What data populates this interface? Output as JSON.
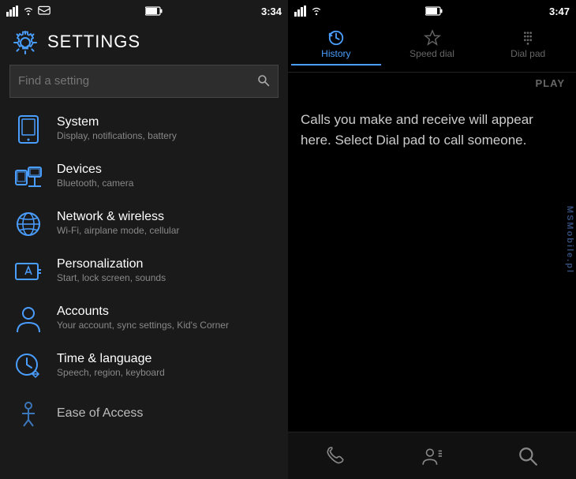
{
  "left_panel": {
    "status_bar": {
      "time": "3:34"
    },
    "header": {
      "title": "SETTINGS",
      "gear_unicode": "⚙"
    },
    "search": {
      "placeholder": "Find a setting",
      "icon": "🔍"
    },
    "settings_items": [
      {
        "id": "system",
        "title": "System",
        "subtitle": "Display, notifications, battery",
        "icon_type": "phone-outline"
      },
      {
        "id": "devices",
        "title": "Devices",
        "subtitle": "Bluetooth, camera",
        "icon_type": "devices"
      },
      {
        "id": "network",
        "title": "Network & wireless",
        "subtitle": "Wi-Fi, airplane mode, cellular",
        "icon_type": "network"
      },
      {
        "id": "personalization",
        "title": "Personalization",
        "subtitle": "Start, lock screen, sounds",
        "icon_type": "personalization"
      },
      {
        "id": "accounts",
        "title": "Accounts",
        "subtitle": "Your account, sync settings, Kid's Corner",
        "icon_type": "accounts"
      },
      {
        "id": "time_language",
        "title": "Time & language",
        "subtitle": "Speech, region, keyboard",
        "icon_type": "time_language"
      },
      {
        "id": "ease_of_access",
        "title": "Ease of Access",
        "subtitle": "",
        "icon_type": "ease"
      }
    ]
  },
  "right_panel": {
    "status_bar": {
      "time": "3:47"
    },
    "tabs": [
      {
        "id": "history",
        "label": "History",
        "active": true,
        "icon": "history"
      },
      {
        "id": "speed_dial",
        "label": "Speed dial",
        "active": false,
        "icon": "star"
      },
      {
        "id": "dial_pad",
        "label": "Dial pad",
        "active": false,
        "icon": "dialpad"
      }
    ],
    "play_button_label": "PLAY",
    "empty_message": "Calls you make and receive will appear here. Select Dial pad to call someone.",
    "bottom_bar": [
      {
        "id": "calls",
        "icon": "calls"
      },
      {
        "id": "contacts",
        "icon": "contacts"
      },
      {
        "id": "search",
        "icon": "search"
      }
    ]
  },
  "watermark": "MSMobile.pl"
}
